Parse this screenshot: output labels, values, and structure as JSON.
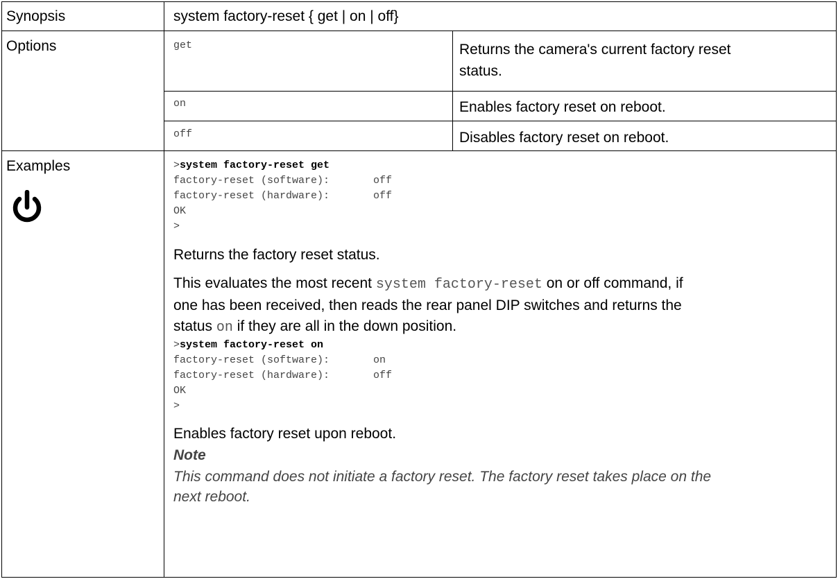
{
  "rows": {
    "synopsis": {
      "label": "Synopsis",
      "value": "system factory-reset { get | on | off}"
    },
    "options": {
      "label": "Options",
      "items": [
        {
          "option": "get",
          "description": "Returns the camera's current factory reset status.",
          "description_line1": "Returns the camera's current factory reset",
          "description_line2": "status."
        },
        {
          "option": "on",
          "description": "Enables factory reset on reboot."
        },
        {
          "option": "off",
          "description": "Disables factory reset on reboot."
        }
      ]
    },
    "examples": {
      "label": "Examples",
      "icon": "power-icon",
      "example1": {
        "prompt": ">",
        "command": "system factory-reset get",
        "line1": "factory-reset (software):       off",
        "line2": "factory-reset (hardware):       off",
        "ok": "OK",
        "end_prompt": ">",
        "summary": "Returns the factory reset status.",
        "detail_part1": "This evaluates the most recent ",
        "detail_code1": "system factory-reset",
        "detail_part2": " on or off command, if",
        "detail_line2": "one has been received, then reads the rear panel DIP switches and returns the",
        "detail_part3": "status ",
        "detail_code2": "on",
        "detail_part4": " if they are all in the down position."
      },
      "example2": {
        "prompt": ">",
        "command": "system factory-reset on",
        "line1": "factory-reset (software):       on",
        "line2": "factory-reset (hardware):       off",
        "ok": "OK",
        "end_prompt": ">",
        "summary": "Enables factory reset upon reboot."
      },
      "note": {
        "title": "Note",
        "body_line1": "This command does not initiate a factory reset. The factory reset takes place on the",
        "body_line2": "next reboot."
      }
    }
  }
}
